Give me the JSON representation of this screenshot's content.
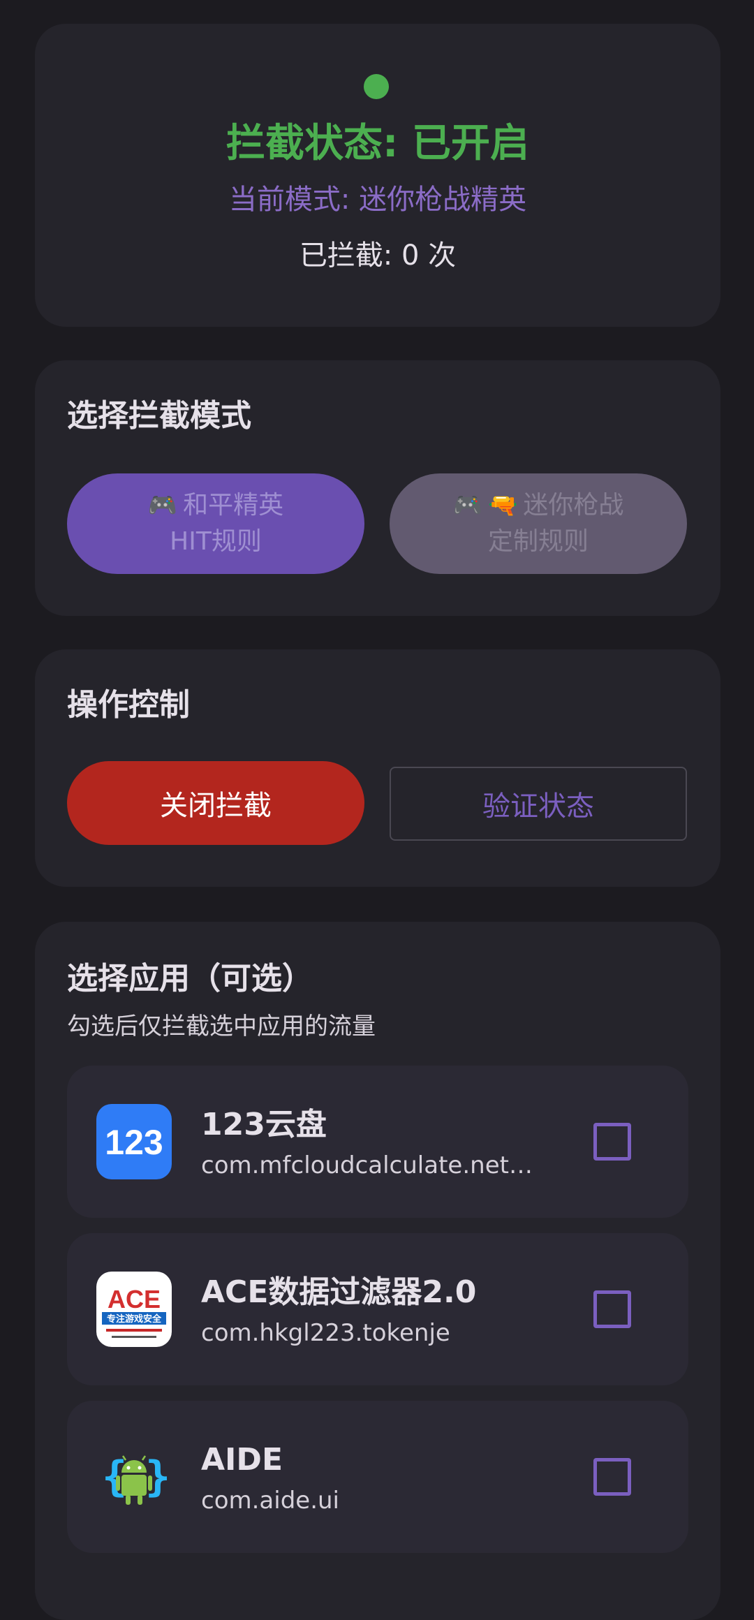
{
  "status": {
    "title": "拦截状态: 已开启",
    "mode": "当前模式: 迷你枪战精英",
    "count": "已拦截: 0 次",
    "color": "#4caf50"
  },
  "mode_section": {
    "title": "选择拦截模式",
    "options": [
      {
        "line1": "和平精英",
        "line2": "HIT规则",
        "icons": [
          "🎮"
        ],
        "selected": true
      },
      {
        "line1": "迷你枪战",
        "line2": "定制规则",
        "icons": [
          "🎮",
          "🔫"
        ],
        "selected": false
      }
    ]
  },
  "control_section": {
    "title": "操作控制",
    "stop_label": "关闭拦截",
    "verify_label": "验证状态"
  },
  "apps_section": {
    "title": "选择应用（可选）",
    "subtitle": "勾选后仅拦截选中应用的流量",
    "apps": [
      {
        "name": "123云盘",
        "package": "com.mfcloudcalculate.netw...",
        "icon": "123-cloud-icon",
        "checked": false
      },
      {
        "name": "ACE数据过滤器2.0",
        "package": "com.hkgl223.tokenje",
        "icon": "ace-icon",
        "icon_text": "ACE",
        "icon_subtext": "专注游戏安全",
        "checked": false
      },
      {
        "name": "AIDE",
        "package": "com.aide.ui",
        "icon": "android-icon",
        "checked": false
      }
    ]
  },
  "colors": {
    "background": "#1c1b20",
    "card": "#25242b",
    "accent": "#6a4fb0",
    "danger": "#b3261e"
  }
}
